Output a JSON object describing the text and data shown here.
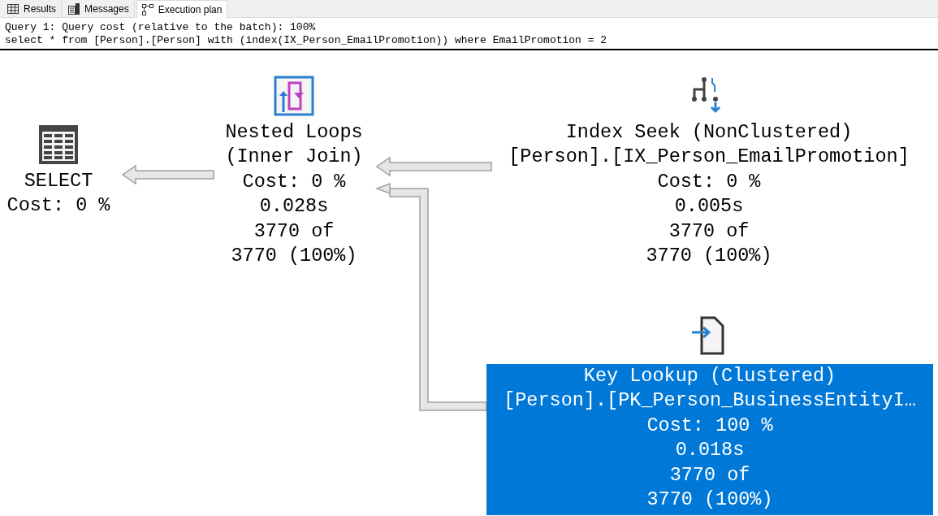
{
  "tabs": [
    {
      "label": "Results",
      "kind": "grid",
      "selected": false
    },
    {
      "label": "Messages",
      "kind": "messages",
      "selected": false
    },
    {
      "label": "Execution plan",
      "kind": "plan",
      "selected": true
    }
  ],
  "query_header": [
    "Query 1: Query cost (relative to the batch): 100%",
    "select * from [Person].[Person] with (index(IX_Person_EmailPromotion)) where EmailPromotion = 2"
  ],
  "plan": {
    "nodes": [
      {
        "kind": "select",
        "selected": false,
        "lines": [
          "SELECT",
          "Cost: 0 %"
        ]
      },
      {
        "kind": "nested_loops",
        "selected": false,
        "lines": [
          "Nested Loops",
          "(Inner Join)",
          "Cost: 0 %",
          "0.028s",
          "3770 of",
          "3770 (100%)"
        ]
      },
      {
        "kind": "index_seek",
        "selected": false,
        "lines": [
          "Index Seek (NonClustered)",
          "[Person].[IX_Person_EmailPromotion]",
          "Cost: 0 %",
          "0.005s",
          "3770 of",
          "3770 (100%)"
        ]
      },
      {
        "kind": "key_lookup",
        "selected": true,
        "lines": [
          "Key Lookup (Clustered)",
          "[Person].[PK_Person_BusinessEntityI…",
          "Cost: 100 %",
          "0.018s",
          "3770 of",
          "3770 (100%)"
        ]
      }
    ]
  }
}
